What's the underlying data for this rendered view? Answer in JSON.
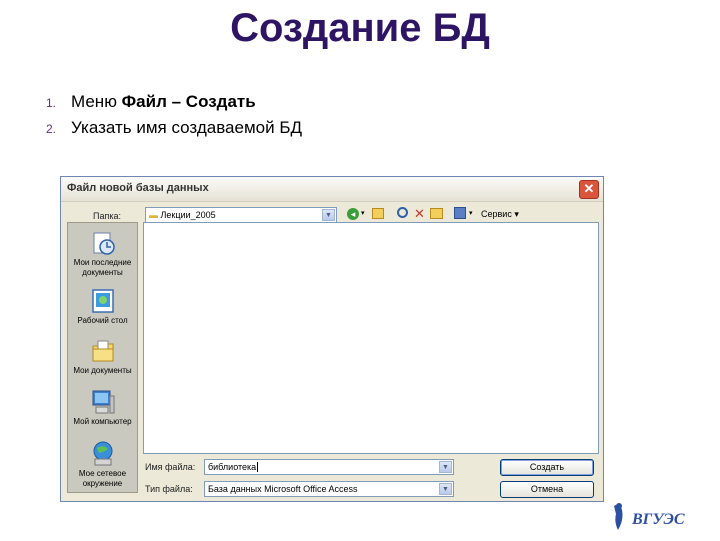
{
  "slide": {
    "title": "Создание БД",
    "steps": [
      {
        "num": "1.",
        "text_plain": "Меню ",
        "text_bold": "Файл – Создать"
      },
      {
        "num": "2.",
        "text_plain": "Указать имя создаваемой БД",
        "text_bold": ""
      }
    ]
  },
  "dialog": {
    "title": "Файл новой базы данных",
    "close_glyph": "✕",
    "folder_label": "Папка:",
    "folder_value": "Лекции_2005",
    "tools_label": "Сервис",
    "places": [
      {
        "label": "Мои последние документы",
        "icon": "recent-documents-icon"
      },
      {
        "label": "Рабочий стол",
        "icon": "desktop-icon"
      },
      {
        "label": "Мои документы",
        "icon": "my-documents-icon"
      },
      {
        "label": "Мой компьютер",
        "icon": "my-computer-icon"
      },
      {
        "label": "Мое сетевое окружение",
        "icon": "network-places-icon"
      }
    ],
    "filename_label": "Имя файла:",
    "filename_value": "библиотека",
    "filetype_label": "Тип файла:",
    "filetype_value": "База данных Microsoft Office Access",
    "create_button": "Создать",
    "cancel_button": "Отмена"
  },
  "logo": {
    "text": "ВГУЭС"
  },
  "colors": {
    "title": "#2e1563",
    "dialog_bg": "#ece9d8",
    "close": "#d9553c"
  }
}
